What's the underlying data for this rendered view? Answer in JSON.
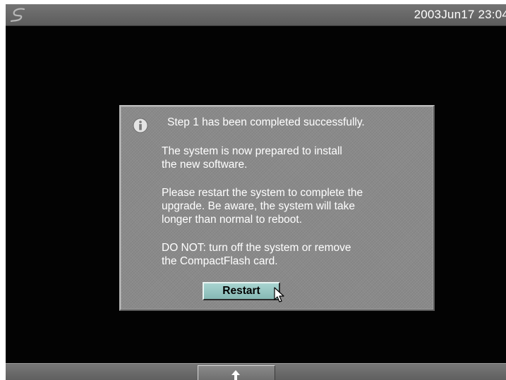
{
  "top_bar": {
    "logo_icon": "swirl-logo-icon",
    "datetime": "2003Jun17 23:04"
  },
  "dialog": {
    "icon": "info-icon",
    "title": "Step 1 has been completed successfully.",
    "paragraphs": [
      [
        "The system is now prepared to install",
        "the new software."
      ],
      [
        "Please restart the system to complete the",
        "upgrade. Be aware, the system will take",
        "longer than normal to reboot."
      ],
      [
        "DO NOT: turn off the system or remove",
        "the CompactFlash card."
      ]
    ],
    "restart_label": "Restart"
  },
  "bottom_bar": {
    "button_icon": "up-arrow-icon"
  },
  "colors": {
    "screen_background": "#030303",
    "dialog_background": "#8a8a8a",
    "button_accent": "#9ccac6",
    "text": "#ffffff"
  }
}
